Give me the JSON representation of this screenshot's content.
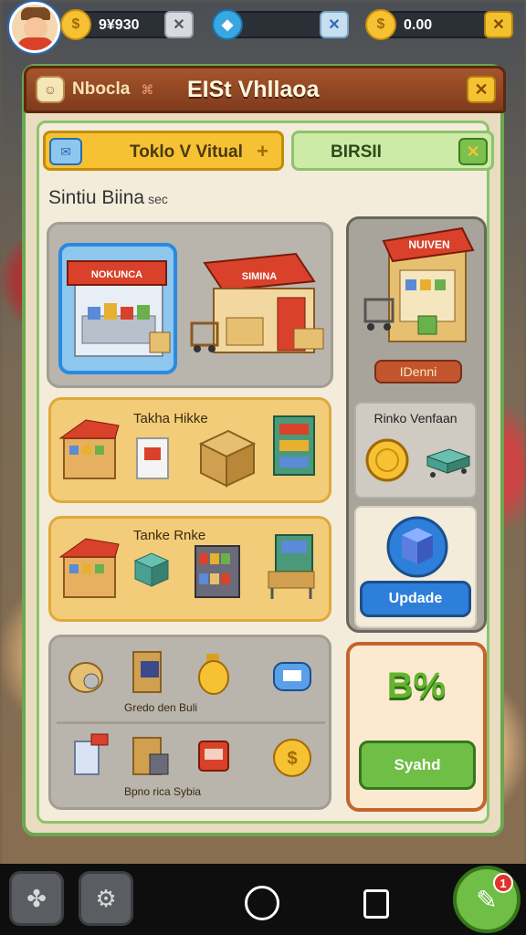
{
  "topbar": {
    "res1": {
      "value": "9¥930",
      "icon": "gold-coin-icon",
      "button_icon": "wrench-icon"
    },
    "res2": {
      "value": "",
      "icon": "blue-gem-icon",
      "button_icon": "wrench-icon"
    },
    "res3": {
      "value": "0.00",
      "icon": "gold-coin-icon",
      "button_icon": "close-icon"
    }
  },
  "panel": {
    "left_label": "Nbocla",
    "left_sub": "⌘",
    "title": "EISt Vhllaoa",
    "close": "✕"
  },
  "tabs": {
    "tab1_label": "Toklo V Vitual",
    "tab1_plus": "+",
    "tab2_label": "BIRSII",
    "tab2_close": "✕"
  },
  "section": {
    "title": "Sintiu Biina",
    "small": "sec"
  },
  "shops": {
    "shop1_sign": "NOKUNCA",
    "shop2_sign": "SIMINA"
  },
  "cards": {
    "t1_label": "Takha Hikke",
    "t2_label": "Tanke Rnke",
    "grid_label1": "Gredo den  Buli",
    "grid_label2": "Bpno rica  Sybia"
  },
  "right": {
    "shop_sign": "NUIVEN",
    "shop_button": "IDenni",
    "info_label": "Rinko Venfaan",
    "update_button": "Updade",
    "bonus_text": "B%",
    "bonus_button": "Syahd"
  },
  "nav": {
    "chat_badge": "1"
  }
}
